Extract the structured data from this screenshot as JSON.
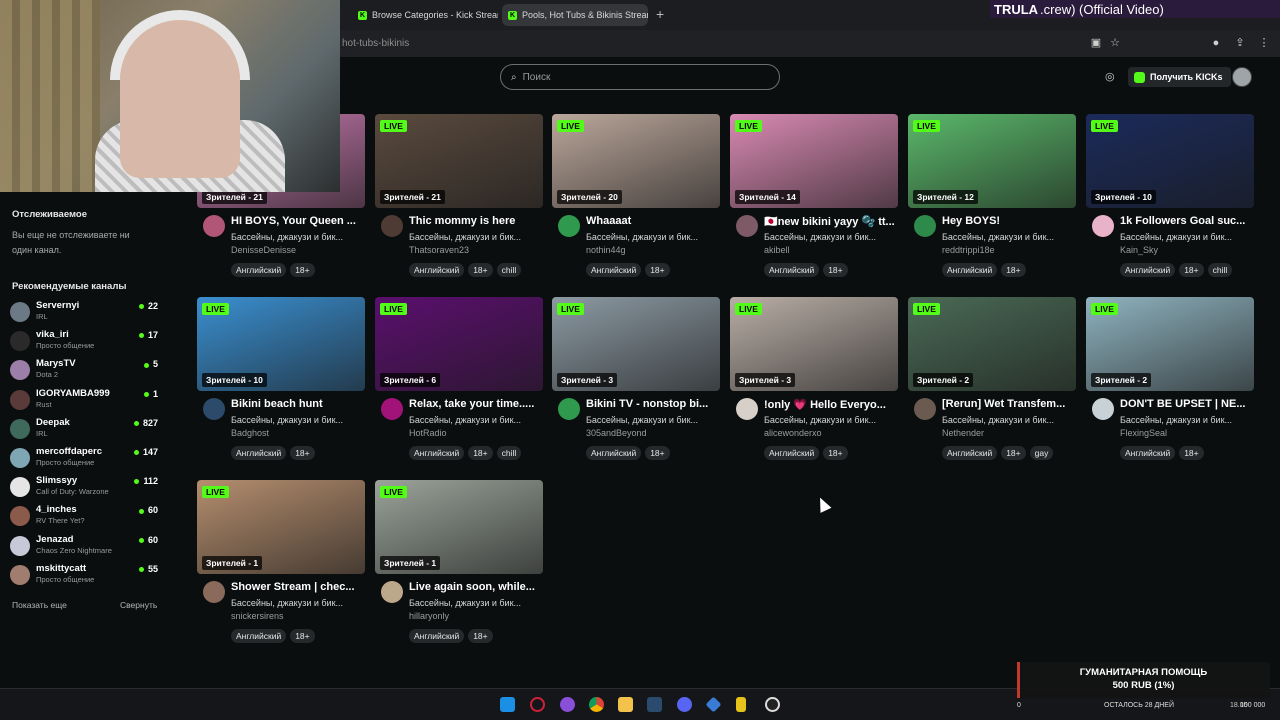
{
  "browser": {
    "tabs": [
      {
        "label": "Browse Categories - Kick Stream",
        "active": false
      },
      {
        "label": "Pools, Hot Tubs & Bikinis Stream",
        "active": true
      }
    ],
    "url_fragment": "hot-tubs-bikinis"
  },
  "overlay": {
    "song_brand": "TRULA",
    "song_text": ".crew) (Official Video)",
    "donation_line1": "ГУМАНИТАРНАЯ ПОМОЩЬ",
    "donation_line2": "500 RUB (1%)",
    "donation_left": "0",
    "donation_mid": "ОСТАЛОСЬ 28 ДНЕЙ",
    "donation_right": "100 000"
  },
  "header": {
    "search_placeholder": "Поиск",
    "kicks_label": "Получить KICKs"
  },
  "sidebar": {
    "following_title": "Отслеживаемое",
    "following_empty": "Вы еще не отслеживаете ни один канал.",
    "recommended_title": "Рекомендуемые каналы",
    "show_more": "Показать еще",
    "collapse": "Свернуть",
    "channels": [
      {
        "name": "Servernyi",
        "category": "IRL",
        "viewers": "22",
        "color": "#6c7a86"
      },
      {
        "name": "vika_iri",
        "category": "Просто общение",
        "viewers": "17",
        "color": "#2a2a2a"
      },
      {
        "name": "MarysTV",
        "category": "Dota 2",
        "viewers": "5",
        "color": "#9b7fa8"
      },
      {
        "name": "IGORYAMBA999",
        "category": "Rust",
        "viewers": "1",
        "color": "#5b3a3a"
      },
      {
        "name": "Deepak",
        "category": "IRL",
        "viewers": "827",
        "color": "#3f6a5b"
      },
      {
        "name": "mercoffdaperc",
        "category": "Просто общение",
        "viewers": "147",
        "color": "#7fa6b3"
      },
      {
        "name": "Slimssyy",
        "category": "Call of Duty: Warzone",
        "viewers": "112",
        "color": "#e5e5e5"
      },
      {
        "name": "4_inches",
        "category": "RV There Yet?",
        "viewers": "60",
        "color": "#8a5a4a"
      },
      {
        "name": "Jenazad",
        "category": "Chaos Zero Nightmare",
        "viewers": "60",
        "color": "#c7c9d8"
      },
      {
        "name": "mskittycatt",
        "category": "Просто общение",
        "viewers": "55",
        "color": "#a17d70"
      }
    ]
  },
  "streams": [
    {
      "viewers": "Зрителей - 21",
      "title": "HI BOYS, Your Queen ...",
      "category": "Бассейны, джакузи и бик...",
      "user": "DenisseDenisse",
      "tags": [
        "Английский",
        "18+"
      ],
      "thumb": "#c97ab0",
      "avatar": "#b25678"
    },
    {
      "viewers": "Зрителей - 21",
      "title": "Thic mommy is here",
      "category": "Бассейны, джакузи и бик...",
      "user": "Thatsoraven23",
      "tags": [
        "Английский",
        "18+",
        "chill"
      ],
      "thumb": "#5a4a3e",
      "avatar": "#4e3b33"
    },
    {
      "viewers": "Зрителей - 20",
      "title": "Whaaaat",
      "category": "Бассейны, джакузи и бик...",
      "user": "nothin44g",
      "tags": [
        "Английский",
        "18+"
      ],
      "thumb": "#bba79b",
      "avatar": "#2f9a4d"
    },
    {
      "viewers": "Зрителей - 14",
      "title": "🇯🇵new bikini yayy 🫧 tt...",
      "category": "Бассейны, джакузи и бик...",
      "user": "akibell",
      "tags": [
        "Английский",
        "18+"
      ],
      "thumb": "#d98ab3",
      "avatar": "#7d5a66"
    },
    {
      "viewers": "Зрителей - 12",
      "title": "Hey BOYS!",
      "category": "Бассейны, джакузи и бик...",
      "user": "reddtrippi18e",
      "tags": [
        "Английский",
        "18+"
      ],
      "thumb": "#5ab86a",
      "avatar": "#2e8a4a"
    },
    {
      "viewers": "Зрителей - 10",
      "title": "1k Followers Goal suc...",
      "category": "Бассейны, джакузи и бик...",
      "user": "Kain_Sky",
      "tags": [
        "Английский",
        "18+",
        "chill"
      ],
      "thumb": "#1b2a5a",
      "avatar": "#e8b3c8"
    },
    {
      "viewers": "Зрителей - 10",
      "title": "Bikini beach hunt",
      "category": "Бассейны, джакузи и бик...",
      "user": "Badghost",
      "tags": [
        "Английский",
        "18+"
      ],
      "thumb": "#3a8fd0",
      "avatar": "#2c4a6a"
    },
    {
      "viewers": "Зрителей - 6",
      "title": "Relax, take your time.....",
      "category": "Бассейны, джакузи и бик...",
      "user": "HotRadio",
      "tags": [
        "Английский",
        "18+",
        "chill"
      ],
      "thumb": "#5b0f6e",
      "avatar": "#a2137a"
    },
    {
      "viewers": "Зрителей - 3",
      "title": "Bikini TV - nonstop bi...",
      "category": "Бассейны, джакузи и бик...",
      "user": "305andBeyond",
      "tags": [
        "Английский",
        "18+"
      ],
      "thumb": "#8c9aa3",
      "avatar": "#2f9a4d"
    },
    {
      "viewers": "Зрителей - 3",
      "title": "!only 💗 Hello Everyo...",
      "category": "Бассейны, джакузи и бик...",
      "user": "alicewonderxo",
      "tags": [
        "Английский",
        "18+"
      ],
      "thumb": "#b9aea6",
      "avatar": "#d7d0c8"
    },
    {
      "viewers": "Зрителей - 2",
      "title": "[Rerun] Wet Transfem...",
      "category": "Бассейны, джакузи и бик...",
      "user": "Nethender",
      "tags": [
        "Английский",
        "18+",
        "gay"
      ],
      "thumb": "#4a6a55",
      "avatar": "#6a5a50"
    },
    {
      "viewers": "Зрителей - 2",
      "title": "DON'T BE UPSET | NE...",
      "category": "Бассейны, джакузи и бик...",
      "user": "FlexingSeal",
      "tags": [
        "Английский",
        "18+"
      ],
      "thumb": "#8fb3bf",
      "avatar": "#c8d2d6"
    },
    {
      "viewers": "Зрителей - 1",
      "title": "Shower Stream | chec...",
      "category": "Бассейны, джакузи и бик...",
      "user": "snickersirens",
      "tags": [
        "Английский",
        "18+"
      ],
      "thumb": "#b58e6e",
      "avatar": "#8a6a5a"
    },
    {
      "viewers": "Зрителей - 1",
      "title": "Live again soon, while...",
      "category": "Бассейны, джакузи и бик...",
      "user": "hillaryonly",
      "tags": [
        "Английский",
        "18+"
      ],
      "thumb": "#9aa39a",
      "avatar": "#bba88a"
    }
  ],
  "live_label": "LIVE"
}
